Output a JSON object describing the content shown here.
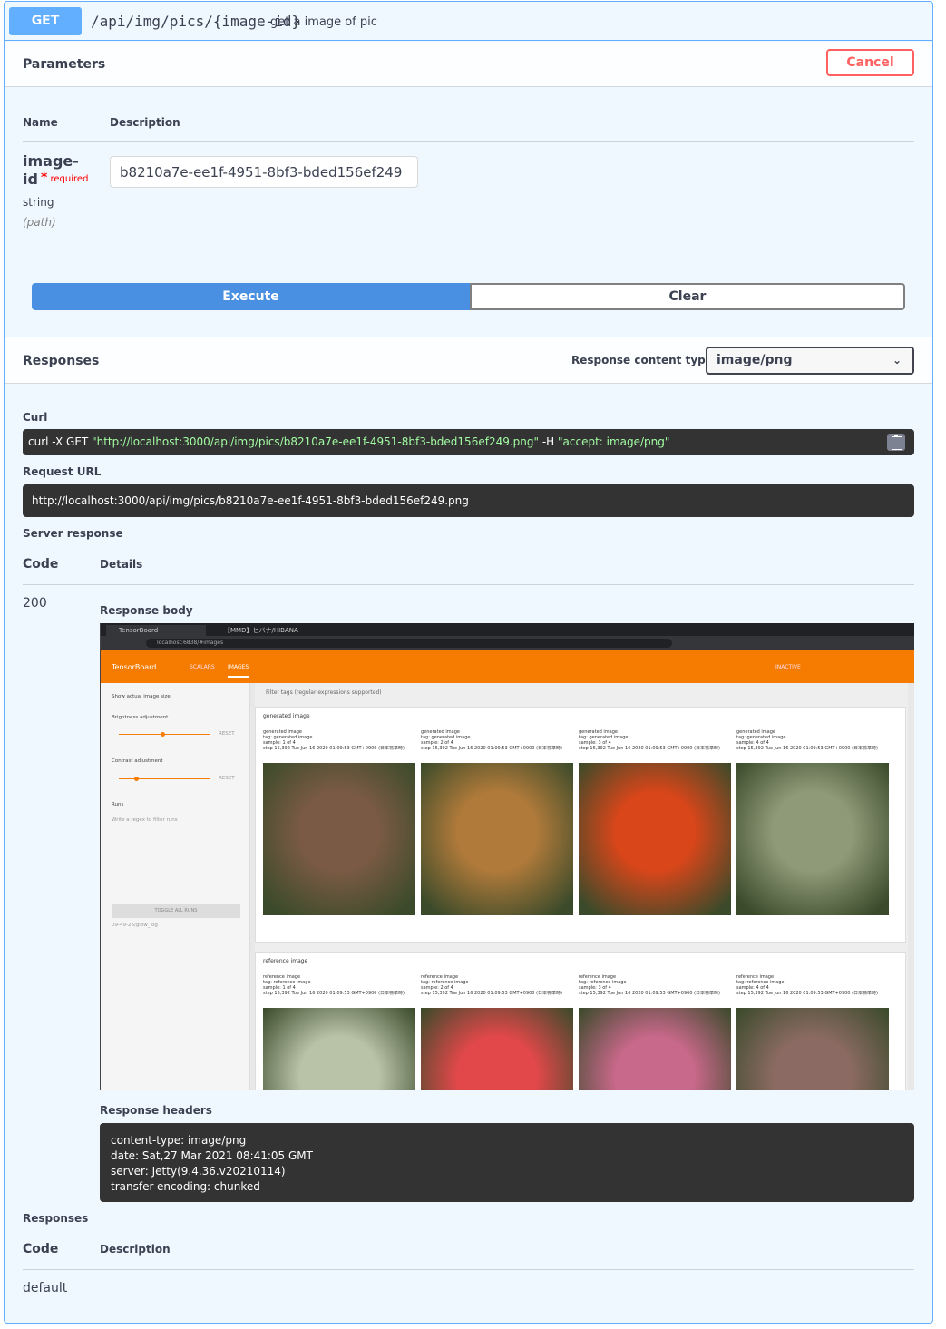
{
  "operation": {
    "method": "GET",
    "path": "/api/img/pics/{image-id}",
    "summary": "get a image of pic"
  },
  "parameters": {
    "title": "Parameters",
    "cancel_label": "Cancel",
    "col_name": "Name",
    "col_description": "Description",
    "param": {
      "name": "image-id",
      "required_label": "required",
      "type": "string",
      "location": "(path)",
      "value": "b8210a7e-ee1f-4951-8bf3-bded156ef249"
    },
    "execute_label": "Execute",
    "clear_label": "Clear"
  },
  "responses_section": {
    "title": "Responses",
    "content_type_label": "Response content type",
    "content_type_value": "image/png",
    "curl_label": "Curl",
    "curl_prefix": "curl -X GET ",
    "curl_url": "\"http://localhost:3000/api/img/pics/b8210a7e-ee1f-4951-8bf3-bded156ef249.png\"",
    "curl_mid": " -H  ",
    "curl_header": "\"accept: image/png\"",
    "request_url_label": "Request URL",
    "request_url": "http://localhost:3000/api/img/pics/b8210a7e-ee1f-4951-8bf3-bded156ef249.png",
    "server_response_label": "Server response",
    "code_col": "Code",
    "details_col": "Details",
    "code": "200",
    "response_body_label": "Response body",
    "response_headers_label": "Response headers",
    "headers": [
      "content-type: image/png",
      "date: Sat,27 Mar 2021 08:41:05 GMT",
      "server: Jetty(9.4.36.v20210114)",
      "transfer-encoding: chunked"
    ]
  },
  "responses_doc": {
    "title": "Responses",
    "code_col": "Code",
    "description_col": "Description",
    "code": "default"
  },
  "screenshot": {
    "tab1": "TensorBoard",
    "tab2": "【MMD】ヒバナ/HIBANA",
    "address": "localhost:6838/#images",
    "brand": "TensorBoard",
    "tab_scalars": "SCALARS",
    "tab_images": "IMAGES",
    "inactive": "INACTIVE",
    "show_actual": "Show actual image size",
    "brightness": "Brightness adjustment",
    "contrast": "Contrast adjustment",
    "reset": "RESET",
    "runs": "Runs",
    "runs_filter": "Write a regex to filter runs",
    "toggle_all": "TOGGLE ALL RUNS",
    "run_name": "09-49-26/glow_log",
    "filter_tags": "Filter tags (regular expressions supported)",
    "generated_header": "generated image",
    "reference_header": "reference image",
    "generated_images": [
      {
        "title": "generated image",
        "tag": "tag: generated image",
        "sample": "sample: 1 of 4",
        "step": "step 15,392   Tue Jun 16 2020 01:09:53 GMT+0900 (日本標準時)",
        "color": "#7a5a44"
      },
      {
        "title": "generated image",
        "tag": "tag: generated image",
        "sample": "sample: 2 of 4",
        "step": "step 15,392   Tue Jun 16 2020 01:09:53 GMT+0900 (日本標準時)",
        "color": "#b07a3a"
      },
      {
        "title": "generated image",
        "tag": "tag: generated image",
        "sample": "sample: 3 of 4",
        "step": "step 15,392   Tue Jun 16 2020 01:09:53 GMT+0900 (日本標準時)",
        "color": "#d8461a"
      },
      {
        "title": "generated image",
        "tag": "tag: generated image",
        "sample": "sample: 4 of 4",
        "step": "step 15,392   Tue Jun 16 2020 01:09:53 GMT+0900 (日本標準時)",
        "color": "#8f9a78"
      }
    ],
    "reference_images": [
      {
        "title": "reference image",
        "tag": "tag: reference image",
        "sample": "sample: 1 of 4",
        "step": "step 15,392   Tue Jun 16 2020 01:09:53 GMT+0900 (日本標準時)",
        "color": "#b9c3a8"
      },
      {
        "title": "reference image",
        "tag": "tag: reference image",
        "sample": "sample: 2 of 4",
        "step": "step 15,392   Tue Jun 16 2020 01:09:53 GMT+0900 (日本標準時)",
        "color": "#e2484a"
      },
      {
        "title": "reference image",
        "tag": "tag: reference image",
        "sample": "sample: 3 of 4",
        "step": "step 15,392   Tue Jun 16 2020 01:09:53 GMT+0900 (日本標準時)",
        "color": "#c8688a"
      },
      {
        "title": "reference image",
        "tag": "tag: reference image",
        "sample": "sample: 4 of 4",
        "step": "step 15,392   Tue Jun 16 2020 01:09:53 GMT+0900 (日本標準時)",
        "color": "#8a6a62"
      }
    ]
  },
  "colors": {
    "get_blue": "#61affe",
    "execute_blue": "#4990e2",
    "cancel_red": "#ff6060",
    "code_bg": "#333333",
    "tensorboard_orange": "#f57c00"
  }
}
